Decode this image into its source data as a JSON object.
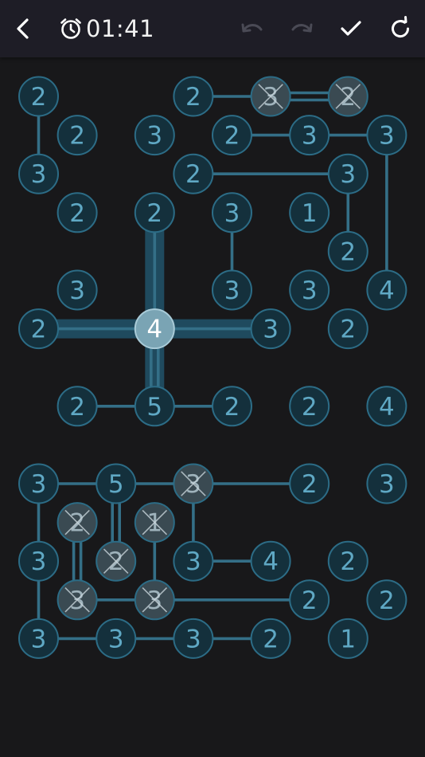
{
  "toolbar": {
    "back_icon": "chevron-left-icon",
    "timer_icon": "alarm-clock-icon",
    "timer_text": "01:41",
    "undo_icon": "undo-icon",
    "redo_icon": "redo-icon",
    "check_icon": "check-icon",
    "restart_icon": "refresh-icon"
  },
  "colors": {
    "background": "#18181a",
    "toolbar": "#1e1d26",
    "node_fill": "#14303c",
    "node_stroke": "#2c6c86",
    "node_text": "#5fa8c4",
    "bridge": "#346f87",
    "selected_fill": "#7aa4b4",
    "selected_text": "#ffffff",
    "selected_highlight": "#1f4a5e",
    "done_fill": "#3a4a52",
    "done_text": "#9fb3bc",
    "icon": "#ffffff",
    "icon_disabled": "#4a4a55"
  },
  "puzzle": {
    "nodes": [
      {
        "id": "a1",
        "r": 0,
        "c": 0,
        "v": "2"
      },
      {
        "id": "a2",
        "r": 0,
        "c": 4,
        "v": "2"
      },
      {
        "id": "a3",
        "r": 0,
        "c": 6,
        "v": "3",
        "done": true
      },
      {
        "id": "a4",
        "r": 0,
        "c": 8,
        "v": "2",
        "done": true
      },
      {
        "id": "b1",
        "r": 1,
        "c": 1,
        "v": "2"
      },
      {
        "id": "b2",
        "r": 1,
        "c": 3,
        "v": "3"
      },
      {
        "id": "b3",
        "r": 1,
        "c": 5,
        "v": "2"
      },
      {
        "id": "b4",
        "r": 1,
        "c": 7,
        "v": "3"
      },
      {
        "id": "b5",
        "r": 1,
        "c": 9,
        "v": "3"
      },
      {
        "id": "c1",
        "r": 2,
        "c": 0,
        "v": "3"
      },
      {
        "id": "c2",
        "r": 2,
        "c": 4,
        "v": "2"
      },
      {
        "id": "c3",
        "r": 2,
        "c": 8,
        "v": "3"
      },
      {
        "id": "d1",
        "r": 3,
        "c": 1,
        "v": "2"
      },
      {
        "id": "d2",
        "r": 3,
        "c": 3,
        "v": "2"
      },
      {
        "id": "d3",
        "r": 3,
        "c": 5,
        "v": "3"
      },
      {
        "id": "d4",
        "r": 3,
        "c": 7,
        "v": "1"
      },
      {
        "id": "e1",
        "r": 4,
        "c": 8,
        "v": "2"
      },
      {
        "id": "f1",
        "r": 5,
        "c": 1,
        "v": "3"
      },
      {
        "id": "f2",
        "r": 5,
        "c": 5,
        "v": "3"
      },
      {
        "id": "f3",
        "r": 5,
        "c": 7,
        "v": "3"
      },
      {
        "id": "f4",
        "r": 5,
        "c": 9,
        "v": "4"
      },
      {
        "id": "g1",
        "r": 6,
        "c": 0,
        "v": "2"
      },
      {
        "id": "g2",
        "r": 6,
        "c": 3,
        "v": "4",
        "selected": true
      },
      {
        "id": "g3",
        "r": 6,
        "c": 6,
        "v": "3"
      },
      {
        "id": "g4",
        "r": 6,
        "c": 8,
        "v": "2"
      },
      {
        "id": "h1",
        "r": 8,
        "c": 1,
        "v": "2"
      },
      {
        "id": "h2",
        "r": 8,
        "c": 3,
        "v": "5"
      },
      {
        "id": "h3",
        "r": 8,
        "c": 5,
        "v": "2"
      },
      {
        "id": "h4",
        "r": 8,
        "c": 7,
        "v": "2"
      },
      {
        "id": "h5",
        "r": 8,
        "c": 9,
        "v": "4"
      },
      {
        "id": "i1",
        "r": 10,
        "c": 0,
        "v": "3"
      },
      {
        "id": "i2",
        "r": 10,
        "c": 2,
        "v": "5"
      },
      {
        "id": "i3",
        "r": 10,
        "c": 4,
        "v": "3",
        "done": true
      },
      {
        "id": "i4",
        "r": 10,
        "c": 7,
        "v": "2"
      },
      {
        "id": "i5",
        "r": 10,
        "c": 9,
        "v": "3"
      },
      {
        "id": "j1",
        "r": 11,
        "c": 1,
        "v": "2",
        "done": true
      },
      {
        "id": "j2",
        "r": 11,
        "c": 3,
        "v": "1",
        "done": true
      },
      {
        "id": "k1",
        "r": 12,
        "c": 0,
        "v": "3"
      },
      {
        "id": "k2",
        "r": 12,
        "c": 2,
        "v": "2",
        "done": true
      },
      {
        "id": "k3",
        "r": 12,
        "c": 4,
        "v": "3"
      },
      {
        "id": "k4",
        "r": 12,
        "c": 6,
        "v": "4"
      },
      {
        "id": "k5",
        "r": 12,
        "c": 8,
        "v": "2"
      },
      {
        "id": "l1",
        "r": 13,
        "c": 1,
        "v": "3",
        "done": true
      },
      {
        "id": "l2",
        "r": 13,
        "c": 3,
        "v": "3",
        "done": true
      },
      {
        "id": "l3",
        "r": 13,
        "c": 7,
        "v": "2"
      },
      {
        "id": "l4",
        "r": 13,
        "c": 9,
        "v": "2"
      },
      {
        "id": "m1",
        "r": 14,
        "c": 0,
        "v": "3"
      },
      {
        "id": "m2",
        "r": 14,
        "c": 2,
        "v": "3"
      },
      {
        "id": "m3",
        "r": 14,
        "c": 4,
        "v": "3"
      },
      {
        "id": "m4",
        "r": 14,
        "c": 6,
        "v": "2"
      },
      {
        "id": "m5",
        "r": 14,
        "c": 8,
        "v": "1"
      }
    ],
    "bridges": [
      {
        "a": "a2",
        "b": "a3",
        "n": 1
      },
      {
        "a": "a3",
        "b": "a4",
        "n": 2
      },
      {
        "a": "a1",
        "b": "c1",
        "n": 1
      },
      {
        "a": "b3",
        "b": "b4",
        "n": 1
      },
      {
        "a": "b4",
        "b": "b5",
        "n": 1
      },
      {
        "a": "c2",
        "b": "c3",
        "n": 1
      },
      {
        "a": "c3",
        "b": "e1",
        "n": 1
      },
      {
        "a": "b5",
        "b": "f4",
        "n": 1
      },
      {
        "a": "d3",
        "b": "f2",
        "n": 1
      },
      {
        "a": "g1",
        "b": "g2",
        "n": 1
      },
      {
        "a": "g2",
        "b": "g3",
        "n": 1
      },
      {
        "a": "d2",
        "b": "g2",
        "n": 1
      },
      {
        "a": "g2",
        "b": "h2",
        "n": 2
      },
      {
        "a": "h1",
        "b": "h2",
        "n": 1
      },
      {
        "a": "h2",
        "b": "h3",
        "n": 1
      },
      {
        "a": "i1",
        "b": "i2",
        "n": 1
      },
      {
        "a": "i2",
        "b": "i3",
        "n": 1
      },
      {
        "a": "i3",
        "b": "i4",
        "n": 1
      },
      {
        "a": "i1",
        "b": "k1",
        "n": 1
      },
      {
        "a": "k1",
        "b": "m1",
        "n": 1
      },
      {
        "a": "i2",
        "b": "k2",
        "n": 2
      },
      {
        "a": "j1",
        "b": "l1",
        "n": 2
      },
      {
        "a": "j2",
        "b": "l2",
        "n": 1
      },
      {
        "a": "i3",
        "b": "k3",
        "n": 1
      },
      {
        "a": "k3",
        "b": "k4",
        "n": 1
      },
      {
        "a": "l1",
        "b": "l2",
        "n": 1
      },
      {
        "a": "l2",
        "b": "l3",
        "n": 1
      },
      {
        "a": "m1",
        "b": "m2",
        "n": 1
      },
      {
        "a": "m2",
        "b": "m3",
        "n": 1
      },
      {
        "a": "m3",
        "b": "m4",
        "n": 1
      }
    ],
    "highlight": {
      "node": "g2",
      "left": "g1",
      "right": "g3",
      "up": "d2",
      "down": "h2"
    }
  }
}
